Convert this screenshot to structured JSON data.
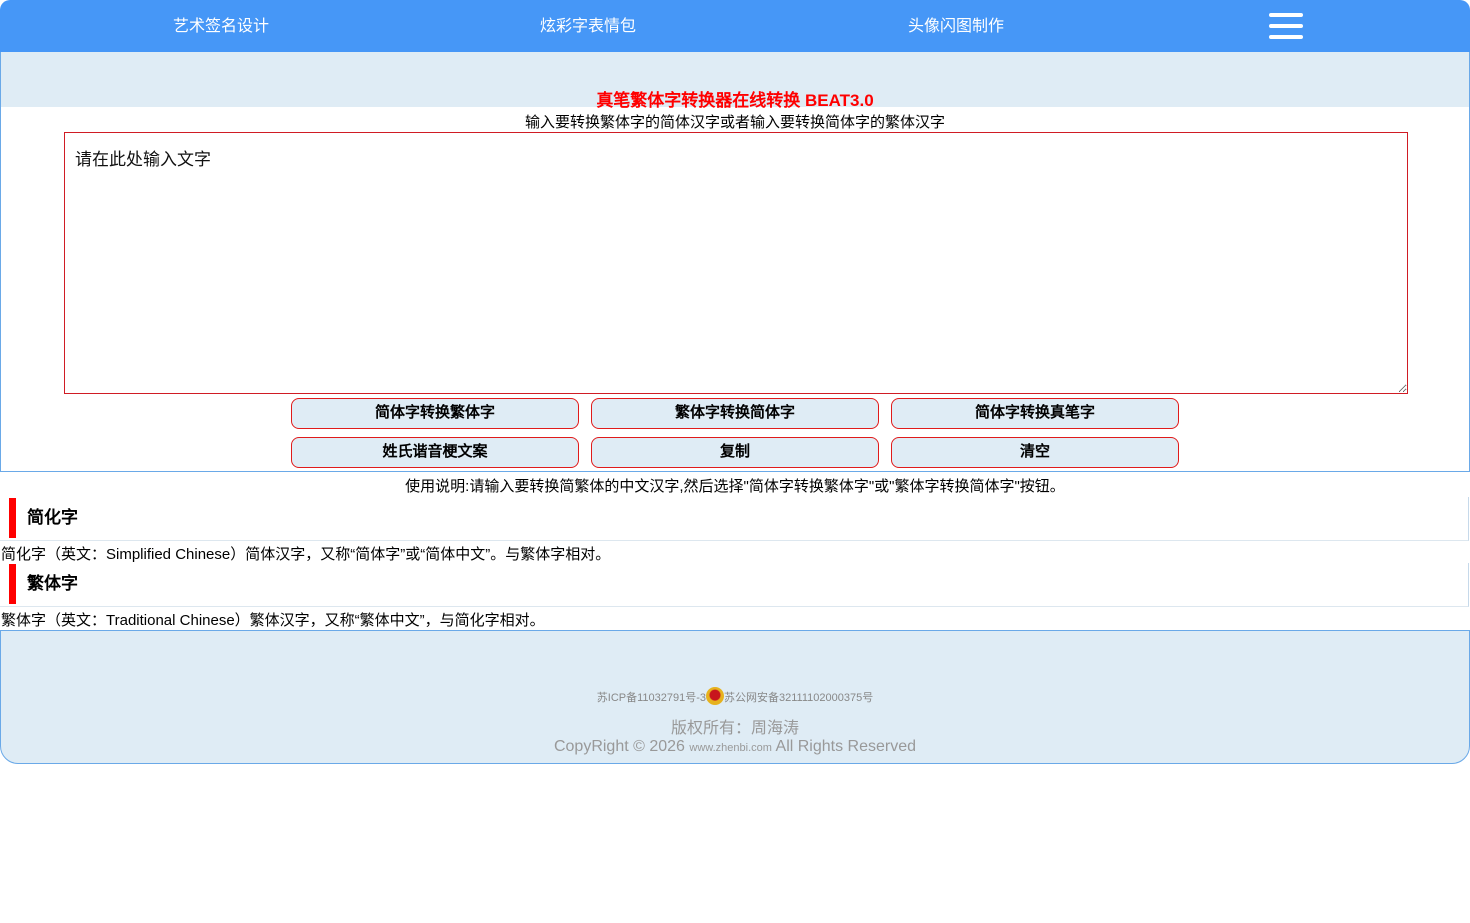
{
  "nav": {
    "items": [
      {
        "label": "艺术签名设计"
      },
      {
        "label": "炫彩字表情包"
      },
      {
        "label": "头像闪图制作"
      }
    ],
    "menu_icon": "hamburger-menu-icon",
    "color": "#4697f7"
  },
  "main": {
    "title": "真笔繁体字转换器在线转换 BEAT3.0",
    "instruction": "输入要转换繁体字的简体汉字或者输入要转换简体字的繁体汉字",
    "textarea_placeholder": "请在此处输入文字",
    "buttons": [
      {
        "label": "简体字转换繁体字"
      },
      {
        "label": "繁体字转换简体字"
      },
      {
        "label": "简体字转换真笔字"
      },
      {
        "label": "姓氏谐音梗文案"
      },
      {
        "label": "复制"
      },
      {
        "label": "清空"
      }
    ],
    "usage": "使用说明:请输入要转换简繁体的中文汉字,然后选择\"简体字转换繁体字\"或\"繁体字转换简体字\"按钮。"
  },
  "sections": [
    {
      "heading": "简化字",
      "text": "简化字（英文：Simplified Chinese）简体汉字，又称“简体字”或“简体中文”。与繁体字相对。"
    },
    {
      "heading": "繁体字",
      "text": "繁体字（英文：Traditional Chinese）繁体汉字，又称“繁体中文”，与简化字相对。"
    }
  ],
  "footer": {
    "icp": "苏ICP备11032791号-3",
    "police": "苏公网安备32111102000375号",
    "badge_icon": "police-badge-icon",
    "owner": "版权所有：周海涛",
    "copyright_prefix": "CopyRight © 2026",
    "domain": "www.zhenbi.com",
    "copyright_suffix": "All Rights Reserved"
  },
  "colors": {
    "accent_red": "#ff0000",
    "panel_bg": "#dfecf5",
    "nav_blue": "#4697f7"
  }
}
